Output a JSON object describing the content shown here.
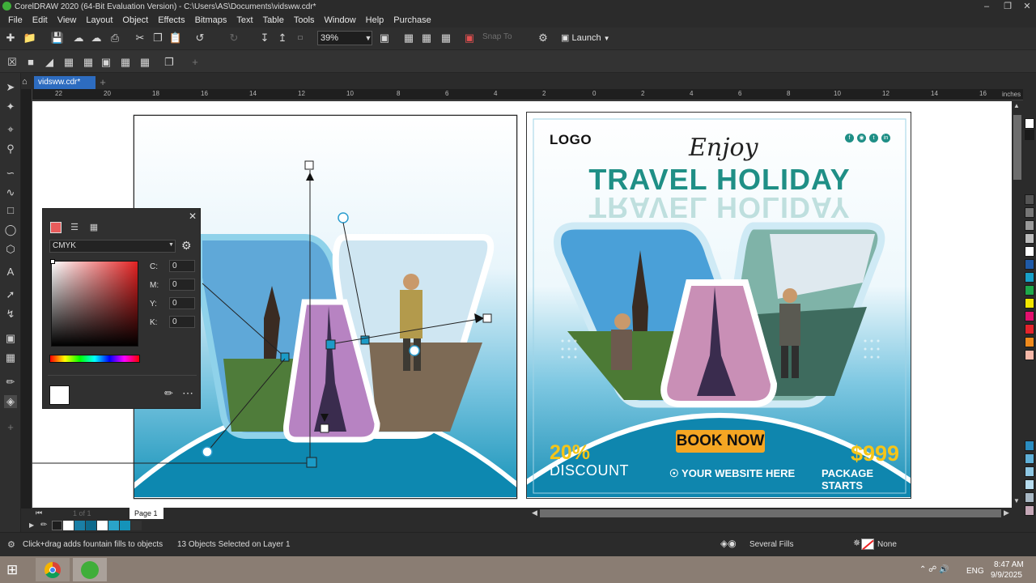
{
  "window": {
    "title": "CorelDRAW 2020 (64-Bit Evaluation Version) - C:\\Users\\AS\\Documents\\vidsww.cdr*"
  },
  "menu": [
    "File",
    "Edit",
    "View",
    "Layout",
    "Object",
    "Effects",
    "Bitmaps",
    "Text",
    "Table",
    "Tools",
    "Window",
    "Help",
    "Purchase"
  ],
  "toolbar": {
    "zoom": "39%",
    "snap_to": "Snap To",
    "launch": "Launch"
  },
  "tabs": {
    "document": "vidsww.cdr*"
  },
  "ruler": {
    "ticks": [
      "22",
      "20",
      "18",
      "16",
      "14",
      "12",
      "10",
      "8",
      "6",
      "4",
      "2",
      "0",
      "2",
      "4",
      "6",
      "8",
      "10",
      "12",
      "14",
      "16"
    ],
    "unit": "inches"
  },
  "color_panel": {
    "model": "CMYK",
    "c_label": "C:",
    "m_label": "M:",
    "y_label": "Y:",
    "k_label": "K:",
    "c": "0",
    "m": "0",
    "y": "0",
    "k": "0"
  },
  "poster": {
    "logo": "LOGO",
    "enjoy": "Enjoy",
    "headline": "TRAVEL HOLIDAY",
    "button": "BOOK NOW",
    "percent": "20%",
    "discount": "DISCOUNT",
    "website": "YOUR WEBSITE HERE",
    "price": "$999",
    "package": "PACKAGE STARTS"
  },
  "page_nav": {
    "page_label": "Page 1",
    "counter": "1 of 1"
  },
  "status": {
    "hint": "Click+drag adds fountain fills to objects",
    "selection": "13 Objects Selected on Layer 1",
    "fill": "Several Fills",
    "outline": "None"
  },
  "taskbar": {
    "lang": "ENG",
    "time": "8:47 AM",
    "date": "9/9/2025"
  },
  "colors": {
    "accent_blue": "#2d6cc0",
    "teal": "#1f8f86",
    "button_orange": "#f5a623",
    "gold": "#f5c518",
    "sky": "#1592b8"
  }
}
